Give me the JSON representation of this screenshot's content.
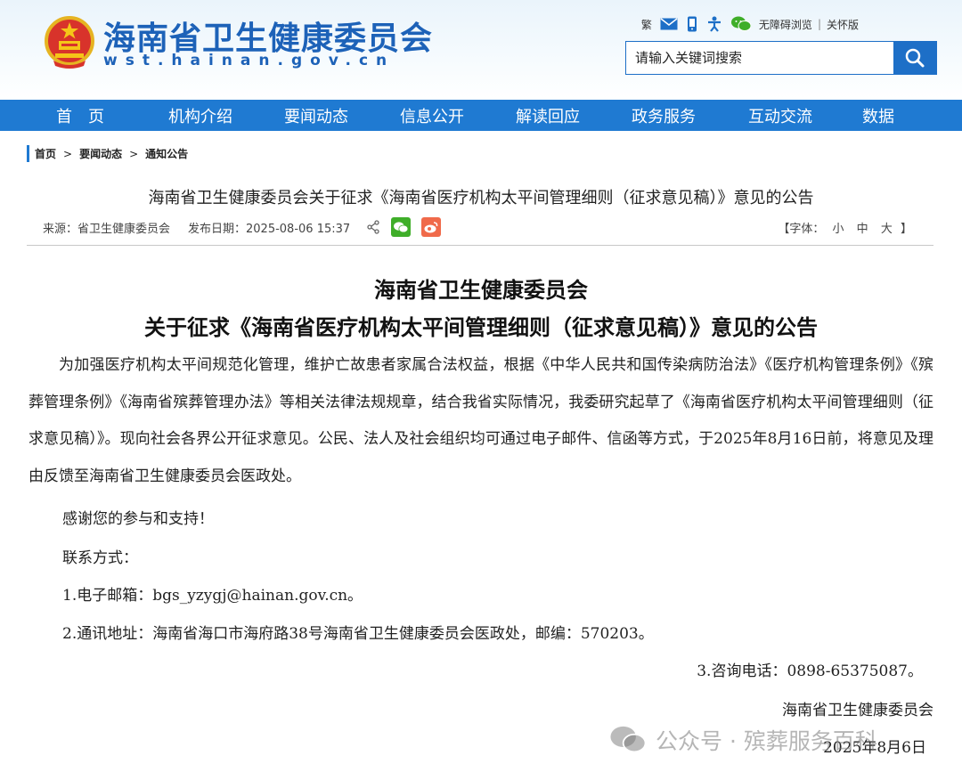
{
  "header": {
    "site_name": "海南省卫生健康委员会",
    "site_domain": "wst.hainan.gov.cn",
    "tools": {
      "traditional": "繁",
      "accessibility": "无障碍浏览",
      "care_mode": "关怀版",
      "separator": "|"
    },
    "search": {
      "placeholder": "请输入关键词搜索"
    }
  },
  "nav": {
    "items": [
      "首　页",
      "机构介绍",
      "要闻动态",
      "信息公开",
      "解读回应",
      "政务服务",
      "互动交流",
      "数据"
    ]
  },
  "breadcrumb": {
    "items": [
      "首页",
      "要闻动态",
      "通知公告"
    ],
    "separator": ">"
  },
  "article": {
    "title": "海南省卫生健康委员会关于征求《海南省医疗机构太平间管理细则（征求意见稿）》意见的公告",
    "source": "来源：省卫生健康委员会",
    "date": "发布日期：2025-08-06 15:37",
    "font_size": {
      "label": "【字体：",
      "small": "小",
      "medium": "中",
      "large": "大",
      "close": "】"
    }
  },
  "body": {
    "heading1": "海南省卫生健康委员会",
    "heading2": "关于征求《海南省医疗机构太平间管理细则（征求意见稿）》意见的公告",
    "paragraph": "为加强医疗机构太平间规范化管理，维护亡故患者家属合法权益，根据《中华人民共和国传染病防治法》《医疗机构管理条例》《殡葬管理条例》《海南省殡葬管理办法》等相关法律法规规章，结合我省实际情况，我委研究起草了《海南省医疗机构太平间管理细则（征求意见稿）》。现向社会各界公开征求意见。公民、法人及社会组织均可通过电子邮件、信函等方式，于2025年8月16日前，将意见及理由反馈至海南省卫生健康委员会医政处。",
    "thanks": "感谢您的参与和支持！",
    "contact_label": "联系方式：",
    "email": "1.电子邮箱：bgs_yzygj@hainan.gov.cn。",
    "address": "2.通讯地址：海南省海口市海府路38号海南省卫生健康委员会医政处，邮编：570203。",
    "phone": "3.咨询电话：0898-65375087。",
    "signature": "海南省卫生健康委员会",
    "sign_date": "2025年8月6日"
  },
  "watermark": "公众号 · 殡葬服务百科",
  "colors": {
    "brand_blue": "#1f7ad2",
    "title_blue": "#1d62b8"
  }
}
